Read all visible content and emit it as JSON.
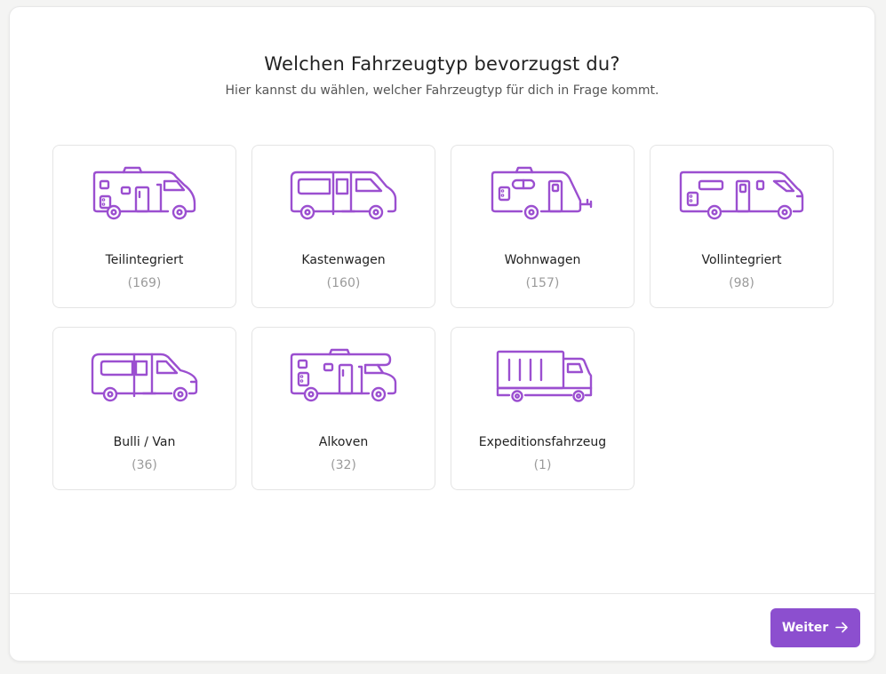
{
  "header": {
    "title": "Welchen Fahrzeugtyp bevorzugst du?",
    "subtitle": "Hier kannst du wählen, welcher Fahrzeugtyp für dich in Frage kommt."
  },
  "vehicles": [
    {
      "name": "Teilintegriert",
      "count": "(169)",
      "icon": "teilintegriert-icon"
    },
    {
      "name": "Kastenwagen",
      "count": "(160)",
      "icon": "kastenwagen-icon"
    },
    {
      "name": "Wohnwagen",
      "count": "(157)",
      "icon": "wohnwagen-icon"
    },
    {
      "name": "Vollintegriert",
      "count": "(98)",
      "icon": "vollintegriert-icon"
    },
    {
      "name": "Bulli / Van",
      "count": "(36)",
      "icon": "van-icon"
    },
    {
      "name": "Alkoven",
      "count": "(32)",
      "icon": "alkoven-icon"
    },
    {
      "name": "Expeditionsfahrzeug",
      "count": "(1)",
      "icon": "expedition-truck-icon"
    }
  ],
  "footer": {
    "next_label": "Weiter",
    "next_icon": "arrow-right-icon"
  },
  "colors": {
    "accent": "#8c4fcf",
    "icon_stroke": "#9b4fd0"
  }
}
